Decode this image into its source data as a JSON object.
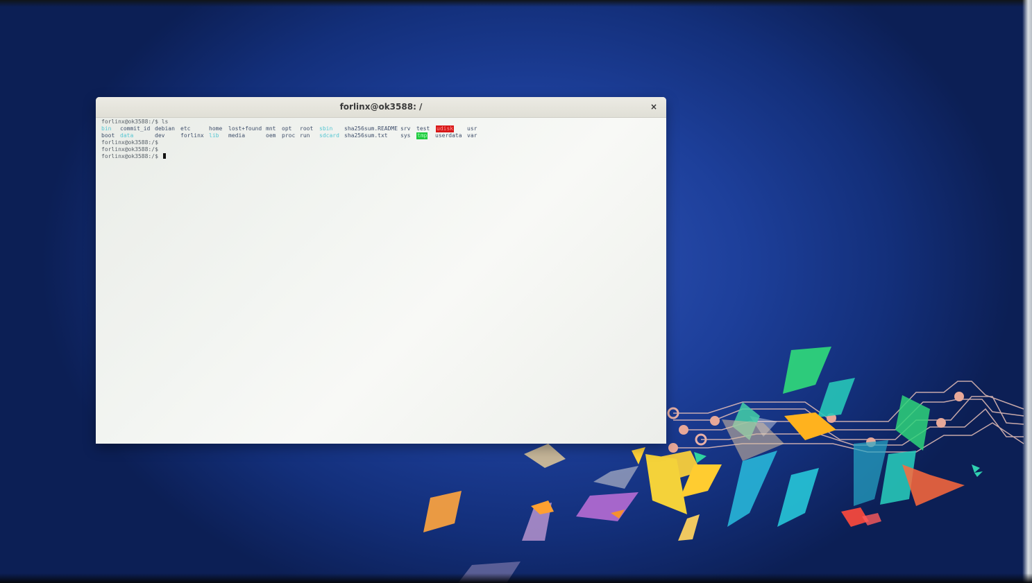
{
  "window": {
    "title": "forlinx@ok3588: /",
    "close_glyph": "×"
  },
  "terminal": {
    "prompt_ls": "forlinx@ok3588:/$ ls",
    "ls_row1": [
      {
        "name": "bin",
        "style": "link"
      },
      {
        "name": "commit_id",
        "style": "plain"
      },
      {
        "name": "debian",
        "style": "plain"
      },
      {
        "name": "etc",
        "style": "plain"
      },
      {
        "name": "home",
        "style": "plain"
      },
      {
        "name": "lost+found",
        "style": "plain"
      },
      {
        "name": "mnt",
        "style": "plain"
      },
      {
        "name": "opt",
        "style": "plain"
      },
      {
        "name": "root",
        "style": "plain"
      },
      {
        "name": "sbin",
        "style": "link"
      },
      {
        "name": "sha256sum.README",
        "style": "plain"
      },
      {
        "name": "srv",
        "style": "plain"
      },
      {
        "name": "test",
        "style": "plain"
      },
      {
        "name": "udisk",
        "style": "red"
      },
      {
        "name": "usr",
        "style": "plain"
      }
    ],
    "ls_row2": [
      {
        "name": "boot",
        "style": "plain"
      },
      {
        "name": "data",
        "style": "link"
      },
      {
        "name": "dev",
        "style": "plain"
      },
      {
        "name": "forlinx",
        "style": "plain"
      },
      {
        "name": "lib",
        "style": "link"
      },
      {
        "name": "media",
        "style": "plain"
      },
      {
        "name": "oem",
        "style": "plain"
      },
      {
        "name": "proc",
        "style": "plain"
      },
      {
        "name": "run",
        "style": "plain"
      },
      {
        "name": "sdcard",
        "style": "link"
      },
      {
        "name": "sha256sum.txt",
        "style": "plain"
      },
      {
        "name": "sys",
        "style": "plain"
      },
      {
        "name": "tmp",
        "style": "green"
      },
      {
        "name": "userdata",
        "style": "plain"
      },
      {
        "name": "var",
        "style": "plain"
      }
    ],
    "prompt_empty_1": "forlinx@ok3588:/$",
    "prompt_empty_2": "forlinx@ok3588:/$",
    "prompt_current": "forlinx@ok3588:/$ "
  },
  "colors": {
    "desktop_blue": "#1d3f9a",
    "link_cyan": "#55c6d2",
    "exec_red": "#d81818",
    "tmp_green": "#1fc93e"
  }
}
